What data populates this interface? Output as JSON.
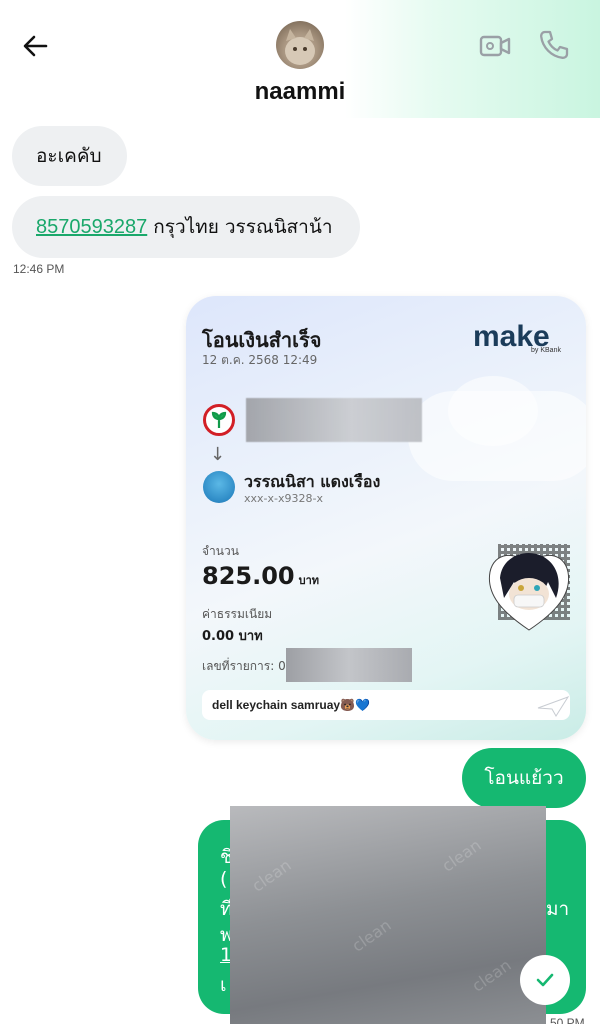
{
  "header": {
    "username": "naammi",
    "back_icon": "arrow-left-icon",
    "video_icon": "video-camera-icon",
    "call_icon": "phone-icon"
  },
  "messages": {
    "incoming_1": "อะเคคับ",
    "incoming_2_account": "8570593287",
    "incoming_2_text": "กรุวไทย วรรณนิสาน้า",
    "incoming_time": "12:46 PM"
  },
  "slip": {
    "title": "โอนเงินสำเร็จ",
    "date": "12 ต.ค. 2568 12:49",
    "logo_text": "make",
    "logo_by": "by KBank",
    "recipient_name": "วรรณนิสา แดงเรือง",
    "recipient_account": "xxx-x-x9328-x",
    "amount_label": "จำนวน",
    "amount_value": "825.00",
    "amount_unit": "บาท",
    "fee_label": "ค่าธรรมเนียม",
    "fee_value": "0.00 บาท",
    "ref_label": "เลขที่รายการ: 04",
    "note": "dell keychain samruay🐻💙"
  },
  "outgoing": {
    "message_1": "โอนแย้วว",
    "message_2_fragments": [
      "ชิ",
      "(",
      "ที",
      "พ",
      "1",
      "เ",
      "มา"
    ],
    "time": "50 PM"
  },
  "colors": {
    "accent_green": "#15b871",
    "link_green": "#1aa86b",
    "incoming_bubble": "#eef0f2"
  }
}
